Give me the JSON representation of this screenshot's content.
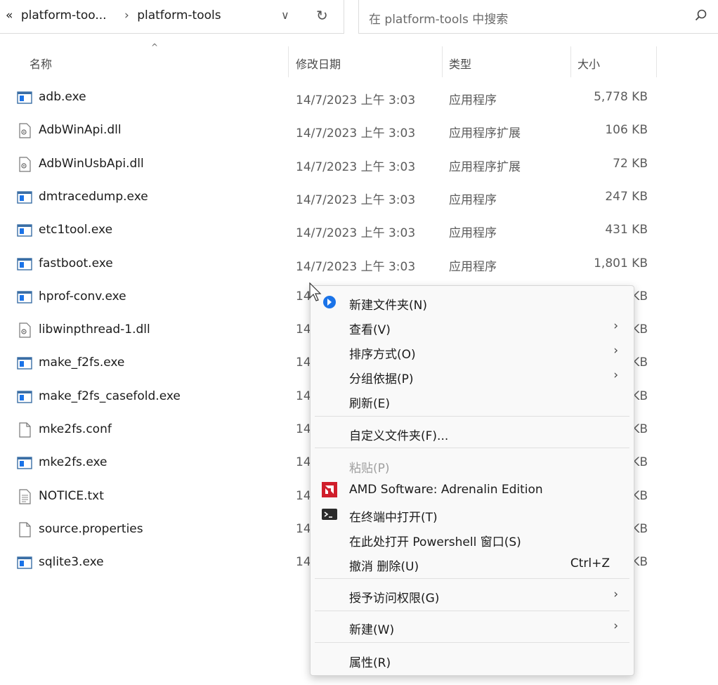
{
  "address": {
    "prefix": "«",
    "crumb1": "platform-too...",
    "sep": "›",
    "crumb2": "platform-tools",
    "dropdown": "∨",
    "refresh": "↻"
  },
  "search": {
    "placeholder": "在 platform-tools 中搜索"
  },
  "columns": {
    "name": "名称",
    "date": "修改日期",
    "type": "类型",
    "size": "大小",
    "sort": "^"
  },
  "files": [
    {
      "name": "adb.exe",
      "date": "14/7/2023 上午 3:03",
      "type": "应用程序",
      "size": "5,778 KB",
      "icon": "exe"
    },
    {
      "name": "AdbWinApi.dll",
      "date": "14/7/2023 上午 3:03",
      "type": "应用程序扩展",
      "size": "106 KB",
      "icon": "dll"
    },
    {
      "name": "AdbWinUsbApi.dll",
      "date": "14/7/2023 上午 3:03",
      "type": "应用程序扩展",
      "size": "72 KB",
      "icon": "dll"
    },
    {
      "name": "dmtracedump.exe",
      "date": "14/7/2023 上午 3:03",
      "type": "应用程序",
      "size": "247 KB",
      "icon": "exe"
    },
    {
      "name": "etc1tool.exe",
      "date": "14/7/2023 上午 3:03",
      "type": "应用程序",
      "size": "431 KB",
      "icon": "exe"
    },
    {
      "name": "fastboot.exe",
      "date": "14/7/2023 上午 3:03",
      "type": "应用程序",
      "size": "1,801 KB",
      "icon": "exe"
    },
    {
      "name": "hprof-conv.exe",
      "date": "14",
      "type": "",
      "size": "KB",
      "icon": "exe"
    },
    {
      "name": "libwinpthread-1.dll",
      "date": "14",
      "type": "",
      "size": "KB",
      "icon": "dll"
    },
    {
      "name": "make_f2fs.exe",
      "date": "14",
      "type": "",
      "size": "KB",
      "icon": "exe"
    },
    {
      "name": "make_f2fs_casefold.exe",
      "date": "14",
      "type": "",
      "size": "KB",
      "icon": "exe"
    },
    {
      "name": "mke2fs.conf",
      "date": "14",
      "type": "",
      "size": "KB",
      "icon": "file"
    },
    {
      "name": "mke2fs.exe",
      "date": "14",
      "type": "",
      "size": "KB",
      "icon": "exe"
    },
    {
      "name": "NOTICE.txt",
      "date": "14",
      "type": "",
      "size": "KB",
      "icon": "txt"
    },
    {
      "name": "source.properties",
      "date": "14",
      "type": "",
      "size": "KB",
      "icon": "file"
    },
    {
      "name": "sqlite3.exe",
      "date": "14",
      "type": "",
      "size": "KB",
      "icon": "exe"
    }
  ],
  "menu": {
    "new_folder": "新建文件夹(N)",
    "view": "查看(V)",
    "sort": "排序方式(O)",
    "group": "分组依据(P)",
    "refresh": "刷新(E)",
    "customize": "自定义文件夹(F)...",
    "paste": "粘贴(P)",
    "amd": "AMD Software: Adrenalin Edition",
    "terminal": "在终端中打开(T)",
    "powershell": "在此处打开 Powershell 窗口(S)",
    "undo": "撤消 删除(U)",
    "undo_shortcut": "Ctrl+Z",
    "access": "授予访问权限(G)",
    "new": "新建(W)",
    "properties": "属性(R)",
    "arrow": "›"
  },
  "colors": {
    "accent": "#0067c0",
    "amd": "#d01e2b"
  }
}
